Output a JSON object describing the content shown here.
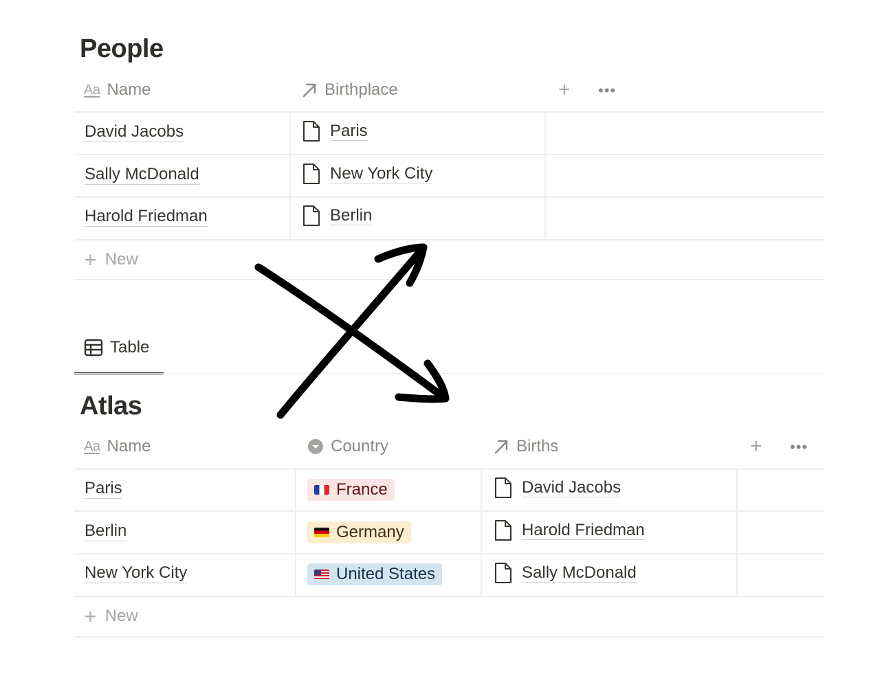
{
  "people": {
    "title": "People",
    "columns": {
      "name": "Name",
      "birthplace": "Birthplace"
    },
    "rows": [
      {
        "name": "David Jacobs",
        "birthplace": "Paris"
      },
      {
        "name": "Sally McDonald",
        "birthplace": "New York City"
      },
      {
        "name": "Harold Friedman",
        "birthplace": "Berlin"
      }
    ],
    "new_label": "New"
  },
  "view_tab": {
    "label": "Table"
  },
  "atlas": {
    "title": "Atlas",
    "columns": {
      "name": "Name",
      "country": "Country",
      "births": "Births"
    },
    "rows": [
      {
        "name": "Paris",
        "country": "France",
        "country_color": "#fbe4e4",
        "births": "David Jacobs"
      },
      {
        "name": "Berlin",
        "country": "Germany",
        "country_color": "#fbeecf",
        "births": "Harold Friedman"
      },
      {
        "name": "New York City",
        "country": "United States",
        "country_color": "#d3e5ef",
        "births": "Sally McDonald"
      }
    ],
    "new_label": "New"
  },
  "icons": {
    "title_property": "Aa",
    "more_label": "•••",
    "add_label": "+"
  }
}
